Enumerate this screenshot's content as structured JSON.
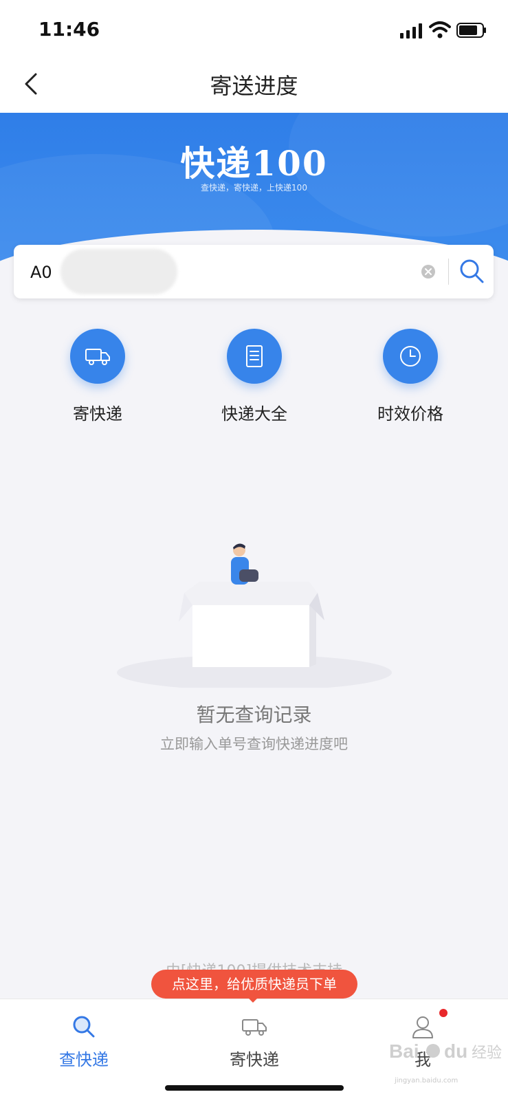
{
  "status_bar": {
    "time": "11:46"
  },
  "nav": {
    "title": "寄送进度"
  },
  "hero": {
    "brand": "快递100",
    "slogan": "查快递，寄快递，上快递100"
  },
  "search": {
    "value": "A0"
  },
  "quick_actions": [
    {
      "label": "寄快递",
      "icon": "truck-icon"
    },
    {
      "label": "快递大全",
      "icon": "document-icon"
    },
    {
      "label": "时效价格",
      "icon": "clock-icon"
    }
  ],
  "empty_state": {
    "title": "暂无查询记录",
    "subtitle": "立即输入单号查询快递进度吧"
  },
  "footer": {
    "tech_support": "由[快递100]提供技术支持"
  },
  "promo": {
    "text": "点这里，给优质快递员下单"
  },
  "tabs": [
    {
      "label": "查快递",
      "icon": "search-icon",
      "active": true
    },
    {
      "label": "寄快递",
      "icon": "truck-icon",
      "active": false
    },
    {
      "label": "我",
      "icon": "user-icon",
      "active": false,
      "badge": true
    }
  ],
  "watermark": {
    "text": "jingyan.baidu.com"
  },
  "colors": {
    "primary": "#3478e5",
    "promo": "#f0543e",
    "badge": "#e8282b"
  }
}
